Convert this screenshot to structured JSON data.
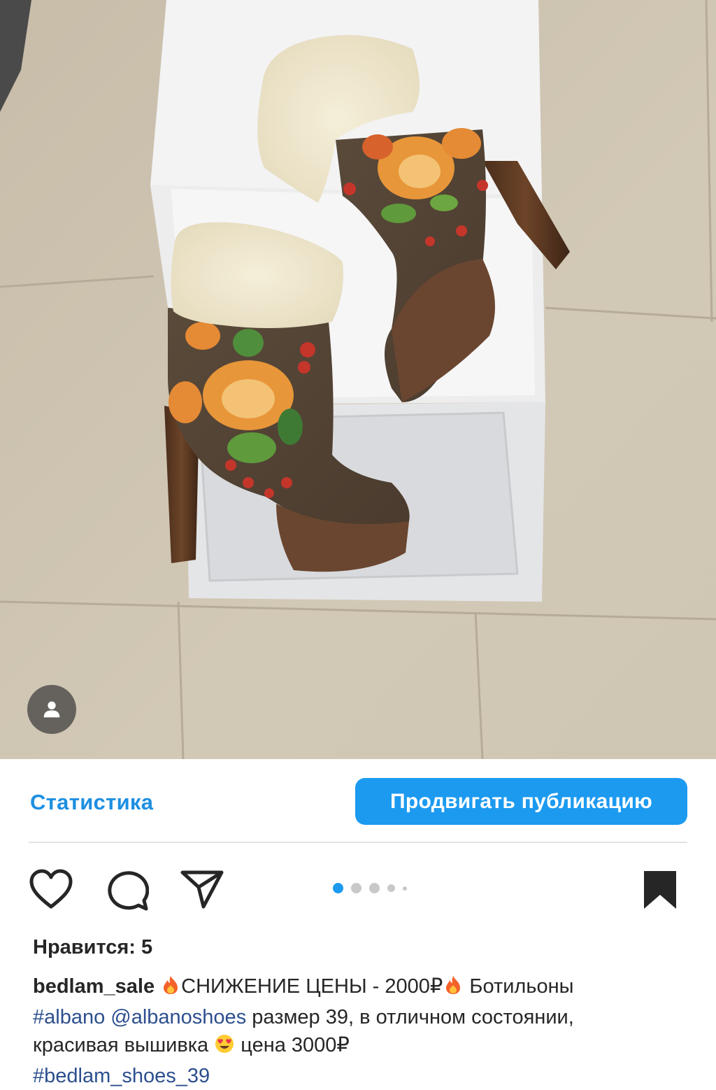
{
  "post": {
    "image_alt": "Embroidered brown platform ankle boots with shearling cuffs on a white box",
    "tag_icon": "person-icon"
  },
  "insights": {
    "label": "Статистика",
    "promote_label": "Продвигать публикацию"
  },
  "actions": {
    "like_icon": "heart-icon",
    "comment_icon": "comment-icon",
    "share_icon": "send-icon",
    "save_icon": "bookmark-icon",
    "carousel_count": 5,
    "carousel_active_index": 0
  },
  "likes": {
    "text": "Нравится: 5"
  },
  "caption": {
    "username": "bedlam_sale",
    "part1": "СНИЖЕНИЕ ЦЕНЫ - 2000₽",
    "part2": " Ботильоны",
    "hashtag1": "#albano",
    "mention": "@albanoshoes",
    "part3": " размер 39, в отличном состоянии,",
    "part4": "красивая вышивка ",
    "part5": " цена 3000₽",
    "hashtag2": "#bedlam_shoes_39"
  },
  "colors": {
    "accent": "#1c9af0",
    "link": "#2c4f8e",
    "text": "#262626"
  }
}
